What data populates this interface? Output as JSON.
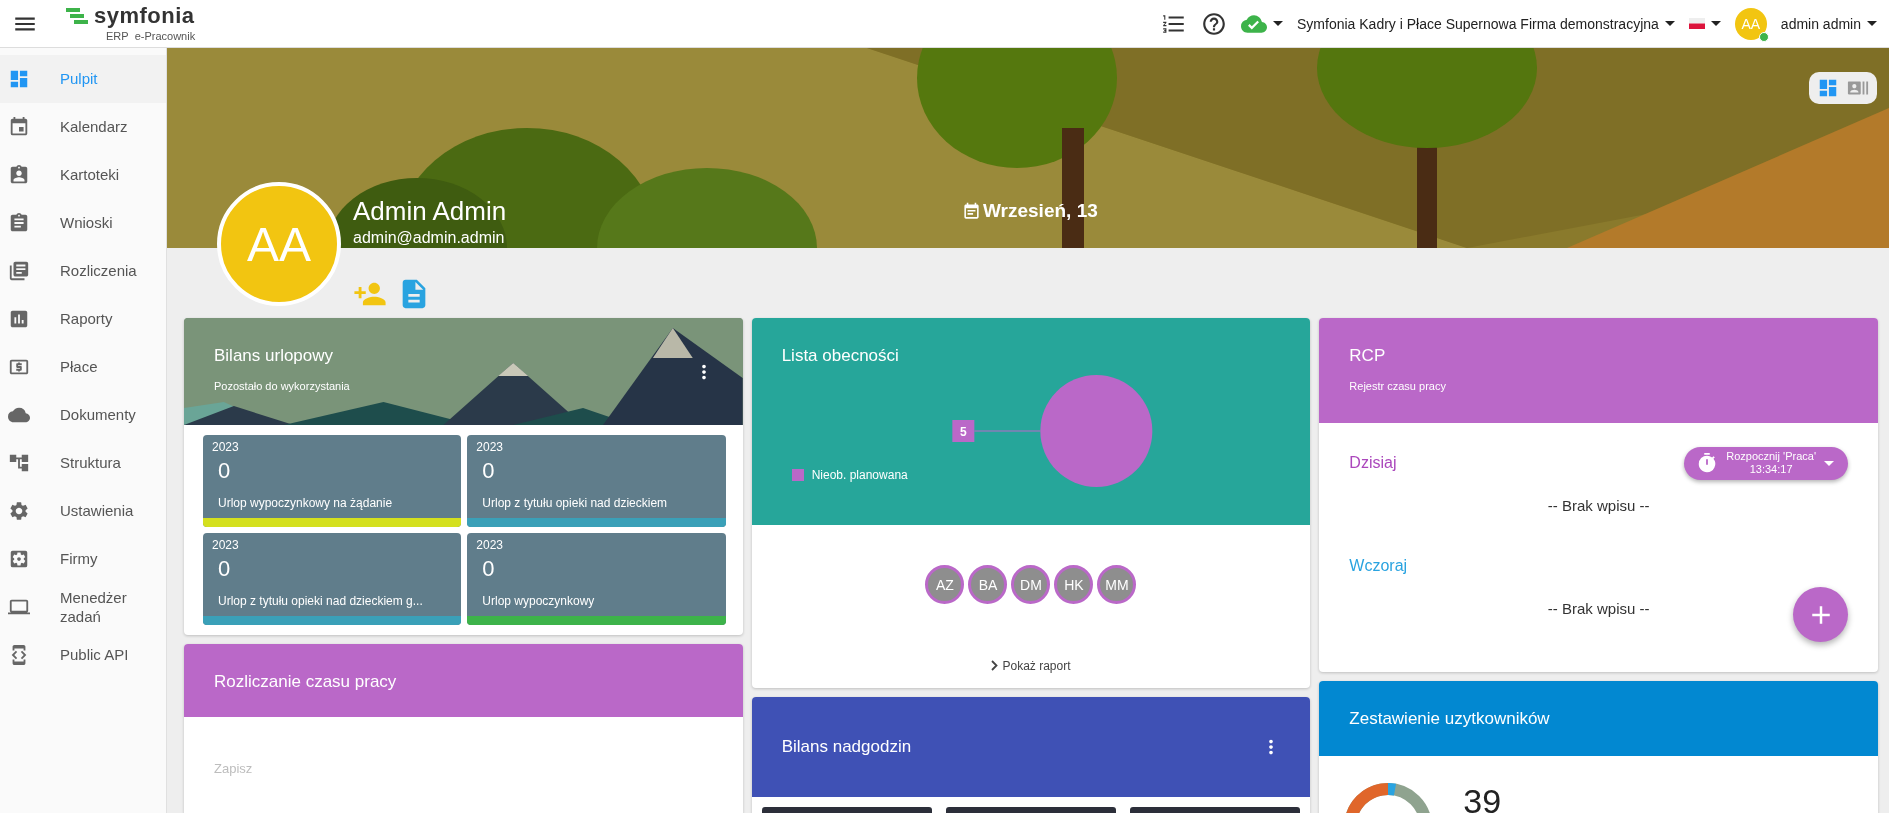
{
  "topbar": {
    "logo": "symfonia",
    "logo_sub_left": "ERP",
    "logo_sub_right": "e-Pracownik",
    "company": "Symfonia Kadry i Płace Supernowa Firma demonstracyjna",
    "user_initials": "AA",
    "user_name": "admin admin",
    "user_online": true
  },
  "sidebar": {
    "items": [
      {
        "label": "Pulpit",
        "selected": true
      },
      {
        "label": "Kalendarz",
        "selected": false
      },
      {
        "label": "Kartoteki",
        "selected": false
      },
      {
        "label": "Wnioski",
        "selected": false
      },
      {
        "label": "Rozliczenia",
        "selected": false
      },
      {
        "label": "Raporty",
        "selected": false
      },
      {
        "label": "Płace",
        "selected": false
      },
      {
        "label": "Dokumenty",
        "selected": false
      },
      {
        "label": "Struktura",
        "selected": false
      },
      {
        "label": "Ustawienia",
        "selected": false
      },
      {
        "label": "Firmy",
        "selected": false
      },
      {
        "label": "Menedżer zadań",
        "selected": false
      },
      {
        "label": "Public API",
        "selected": false
      }
    ]
  },
  "profile": {
    "initials": "AA",
    "name": "Admin Admin",
    "email": "admin@admin.admin",
    "date": "Wrzesień, 13"
  },
  "view_toggle": [
    {
      "selected": true
    },
    {
      "selected": false
    }
  ],
  "leave_balance": {
    "title": "Bilans urlopowy",
    "subtitle": "Pozostało do wykorzystania",
    "tiles": [
      {
        "year": "2023",
        "value": "0",
        "label": "Urlop wypoczynkowy na żądanie",
        "color": "#d4e01e"
      },
      {
        "year": "2023",
        "value": "0",
        "label": "Urlop z tytułu opieki nad dzieckiem",
        "color": "#3aa0b8"
      },
      {
        "year": "2023",
        "value": "0",
        "label": "Urlop z tytułu opieki nad dzieckiem g...",
        "color": "#3aa0b8"
      },
      {
        "year": "2023",
        "value": "0",
        "label": "Urlop wypoczynkowy",
        "color": "#3db34a"
      }
    ]
  },
  "attendance": {
    "title": "Lista obecności",
    "chart_data": {
      "type": "pie",
      "series": [
        {
          "name": "Nieob. planowana",
          "color": "#ba68c8",
          "values": [
            5
          ]
        }
      ],
      "data_labels": true
    },
    "people": [
      "AZ",
      "BA",
      "DM",
      "HK",
      "MM"
    ],
    "report_link": "Pokaż raport"
  },
  "rcp": {
    "title": "RCP",
    "subtitle": "Rejestr czasu pracy",
    "start_button": {
      "label": "Rozpocznij 'Praca'",
      "time": "13:34:17"
    },
    "days": [
      {
        "label": "Dzisiaj",
        "color": "#ab47bc",
        "empty_text": "-- Brak wpisu --"
      },
      {
        "label": "Wczoraj",
        "color": "#29a3e0",
        "empty_text": "-- Brak wpisu --"
      }
    ]
  },
  "work_time": {
    "title": "Rozliczanie czasu pracy",
    "save_button": {
      "label": "Zapisz",
      "disabled": true
    }
  },
  "overtime": {
    "title": "Bilans nadgodzin"
  },
  "users_summary": {
    "title": "Zestawienie uzytkowników",
    "total": "39"
  }
}
